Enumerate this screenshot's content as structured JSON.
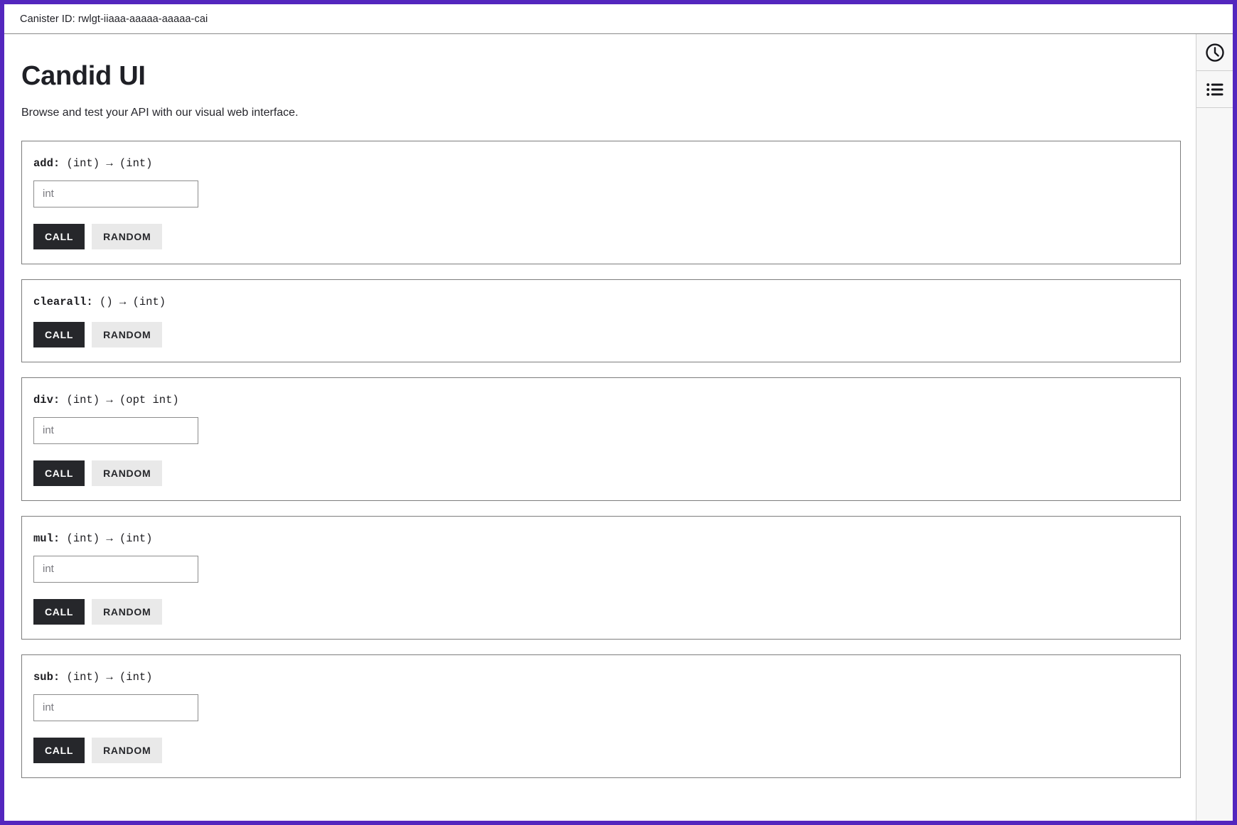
{
  "window": {
    "accent_border_color": "#5326be",
    "background_color": "#ffffff"
  },
  "canister": {
    "label": "Canister ID: rwlgt-iiaaa-aaaaa-aaaaa-cai"
  },
  "header": {
    "title": "Candid UI",
    "subtitle": "Browse and test your API with our visual web interface."
  },
  "buttons": {
    "call_label": "CALL",
    "random_label": "RANDOM",
    "call_bg": "#26272b",
    "random_bg": "#e9e9e9"
  },
  "methods": [
    {
      "name": "add",
      "separator": ": ",
      "params": "(int)",
      "arrow": "→",
      "returns": "(int)",
      "has_input": true,
      "input_placeholder": "int",
      "input_value": ""
    },
    {
      "name": "clearall",
      "separator": ": ",
      "params": "()",
      "arrow": "→",
      "returns": "(int)",
      "has_input": false,
      "input_placeholder": "",
      "input_value": ""
    },
    {
      "name": "div",
      "separator": ": ",
      "params": "(int)",
      "arrow": "→",
      "returns": "(opt int)",
      "has_input": true,
      "input_placeholder": "int",
      "input_value": ""
    },
    {
      "name": "mul",
      "separator": ": ",
      "params": "(int)",
      "arrow": "→",
      "returns": "(int)",
      "has_input": true,
      "input_placeholder": "int",
      "input_value": ""
    },
    {
      "name": "sub",
      "separator": ": ",
      "params": "(int)",
      "arrow": "→",
      "returns": "(int)",
      "has_input": true,
      "input_placeholder": "int",
      "input_value": ""
    }
  ],
  "right_rail": {
    "items": [
      {
        "icon": "clock-icon",
        "label": ""
      },
      {
        "icon": "bulleted-list-icon",
        "label": ""
      }
    ]
  }
}
